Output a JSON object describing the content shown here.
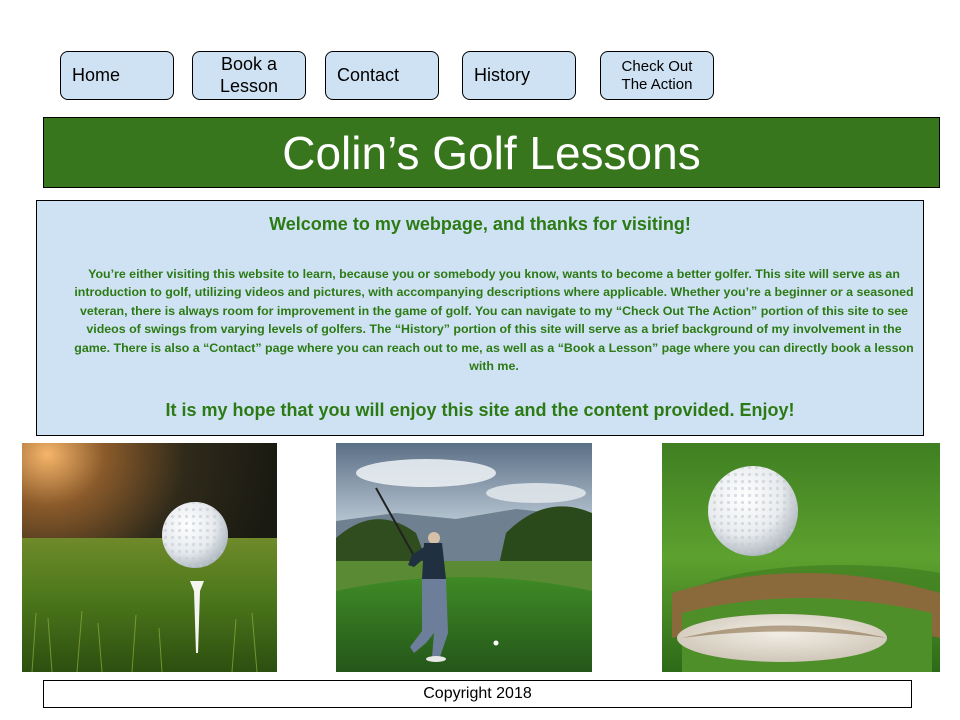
{
  "nav": {
    "home": "Home",
    "book": "Book a\nLesson",
    "contact": "Contact",
    "history": "History",
    "action": "Check Out\nThe Action"
  },
  "header": {
    "title": "Colin’s Golf Lessons"
  },
  "welcome": {
    "heading": "Welcome to my webpage, and thanks for visiting!",
    "body": "You’re either visiting this website to learn, because you or somebody you know, wants to become a better golfer. This site will serve as an introduction to golf, utilizing videos and pictures, with accompanying descriptions where applicable. Whether you’re a beginner or a seasoned veteran, there is always room for improvement in the game of golf. You can navigate to my “Check Out The Action” portion of this site to see videos of swings from varying levels of golfers. The “History” portion of this site will serve as a brief background of my involvement in the game. There is also a “Contact” page where you can reach out to me, as well as a “Book a Lesson” page where you can directly book a lesson with me.",
    "closing": "It is my hope that you will enjoy this site and the content provided. Enjoy!"
  },
  "photos": [
    {
      "icon": "golf-ball-on-tee-photo"
    },
    {
      "icon": "golfer-swing-photo"
    },
    {
      "icon": "golf-ball-near-cup-photo"
    }
  ],
  "footer": {
    "copyright": "Copyright 2018"
  },
  "colors": {
    "nav_bg": "#cfe2f3",
    "title_bg": "#38761d",
    "welcome_bg": "#cfe2f3",
    "welcome_text": "#2c7a14"
  }
}
